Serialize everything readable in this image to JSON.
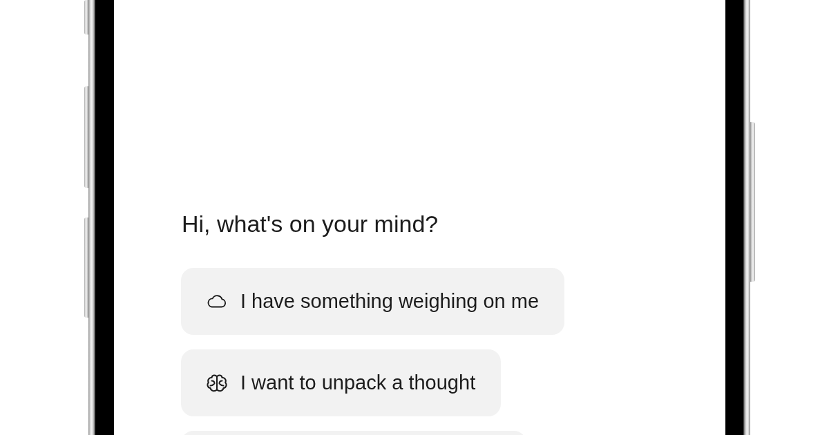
{
  "greeting": "Hi, what's on your mind?",
  "suggestions": [
    {
      "kind": "chip",
      "label": "I have something weighing on me"
    },
    {
      "kind": "chip",
      "label": "I want to unpack a thought"
    },
    {
      "kind": "cut_off"
    }
  ]
}
